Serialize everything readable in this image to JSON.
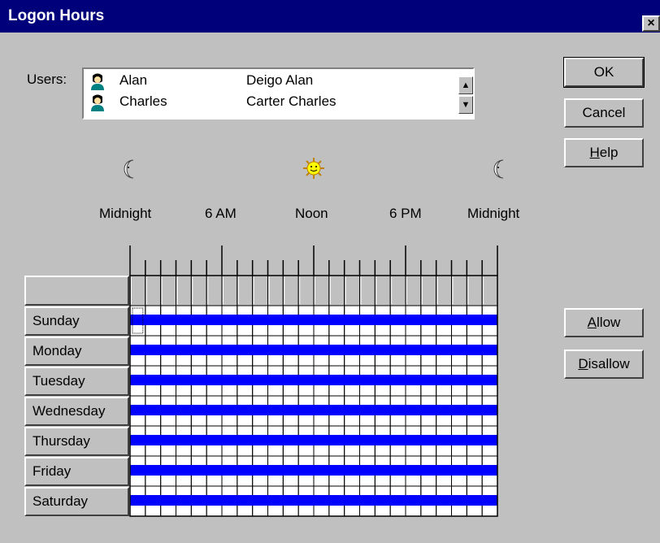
{
  "window": {
    "title": "Logon Hours",
    "close_label": "×"
  },
  "users": {
    "label": "Users:",
    "items": [
      {
        "name": "Alan",
        "full_name": "Deigo Alan"
      },
      {
        "name": "Charles",
        "full_name": "Carter Charles"
      }
    ]
  },
  "buttons": {
    "ok": "OK",
    "cancel": "Cancel",
    "help": "Help",
    "allow": "Allow",
    "disallow": "Disallow"
  },
  "time_labels": [
    "Midnight",
    "6 AM",
    "Noon",
    "6 PM",
    "Midnight"
  ],
  "days": [
    "Sunday",
    "Monday",
    "Tuesday",
    "Wednesday",
    "Thursday",
    "Friday",
    "Saturday"
  ],
  "schedule": {
    "hours_per_day": 24,
    "allowed_all_hours": true
  },
  "colors": {
    "title_bg": "#00007b",
    "allowed": "#0000ff",
    "face": "#c0c0c0"
  },
  "icons": [
    "moon-icon",
    "sun-icon",
    "user-icon"
  ]
}
